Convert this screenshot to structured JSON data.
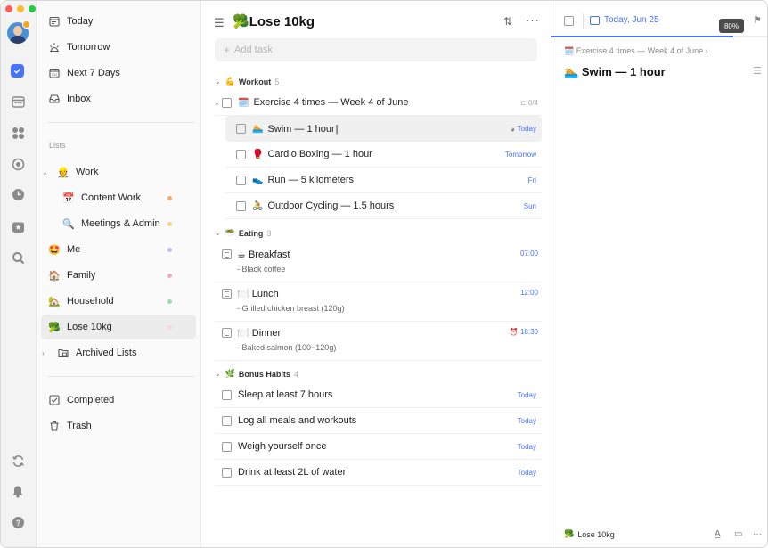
{
  "window": {
    "title": "Lose 10kg"
  },
  "sidebar": {
    "smart_lists": [
      {
        "label": "Today",
        "icon": "calendar-day-icon"
      },
      {
        "label": "Tomorrow",
        "icon": "sunrise-icon"
      },
      {
        "label": "Next 7 Days",
        "icon": "calendar-week-icon"
      },
      {
        "label": "Inbox",
        "icon": "inbox-icon"
      }
    ],
    "lists_header": "Lists",
    "lists": [
      {
        "label": "Work",
        "emoji": "👷"
      },
      {
        "label": "Content Work",
        "emoji": "📅",
        "dot": "#f5a86b"
      },
      {
        "label": "Meetings & Admin",
        "emoji": "🔍",
        "dot": "#f3d27c"
      },
      {
        "label": "Me",
        "emoji": "🤩",
        "dot": "#c9b8f2"
      },
      {
        "label": "Family",
        "emoji": "🏠",
        "dot": "#f2a9c8"
      },
      {
        "label": "Household",
        "emoji": "🏡",
        "dot": "#9fdbb0"
      },
      {
        "label": "Lose 10kg",
        "emoji": "🥦",
        "dot": "#f8d6d6"
      },
      {
        "label": "Archived Lists"
      }
    ],
    "bottom": [
      {
        "label": "Completed"
      },
      {
        "label": "Trash"
      }
    ]
  },
  "main": {
    "title": "Lose 10kg",
    "title_emoji": "🥦",
    "add_placeholder": "Add task",
    "sections": [
      {
        "name": "Workout",
        "emoji": "💪",
        "count": "5"
      },
      {
        "name": "Eating",
        "emoji": "🥗",
        "count": "3"
      },
      {
        "name": "Bonus Habits",
        "emoji": "🌿",
        "count": "4"
      }
    ],
    "workout_parent": {
      "label": "Exercise 4 times — Week 4 of June",
      "emoji": "🗓️",
      "sub_count": "0/4"
    },
    "workout_tasks": [
      {
        "label": "Swim — 1 hour",
        "emoji": "🏊",
        "due": "Today"
      },
      {
        "label": "Cardio Boxing — 1 hour",
        "emoji": "🥊",
        "due": "Tomorrow"
      },
      {
        "label": "Run — 5 kilometers",
        "emoji": "👟",
        "due": "Fri"
      },
      {
        "label": "Outdoor Cycling — 1.5 hours",
        "emoji": "🚴",
        "due": "Sun"
      }
    ],
    "eating_notes": [
      {
        "label": "Breakfast",
        "emoji": "☕",
        "desc": "- Black coffee",
        "time": "07:00"
      },
      {
        "label": "Lunch",
        "emoji": "🍽️",
        "desc": "- Grilled chicken breast (120g)",
        "time": "12:00"
      },
      {
        "label": "Dinner",
        "emoji": "🍽️",
        "desc": "- Baked salmon (100~120g)",
        "time": "18:30"
      }
    ],
    "habits": [
      {
        "label": "Sleep at least 7 hours",
        "due": "Today"
      },
      {
        "label": "Log all meals and workouts",
        "due": "Today"
      },
      {
        "label": "Weigh yourself once",
        "due": "Today"
      },
      {
        "label": "Drink at least 2L of water",
        "due": "Today"
      }
    ]
  },
  "detail": {
    "date": "Today, Jun 25",
    "progress_pct": "80%",
    "breadcrumb": "Exercise 4 times — Week 4 of June",
    "title": "Swim — 1 hour",
    "title_emoji": "🏊",
    "list_name": "Lose 10kg",
    "list_emoji": "🥦"
  },
  "colors": {
    "accent": "#4772fa"
  }
}
